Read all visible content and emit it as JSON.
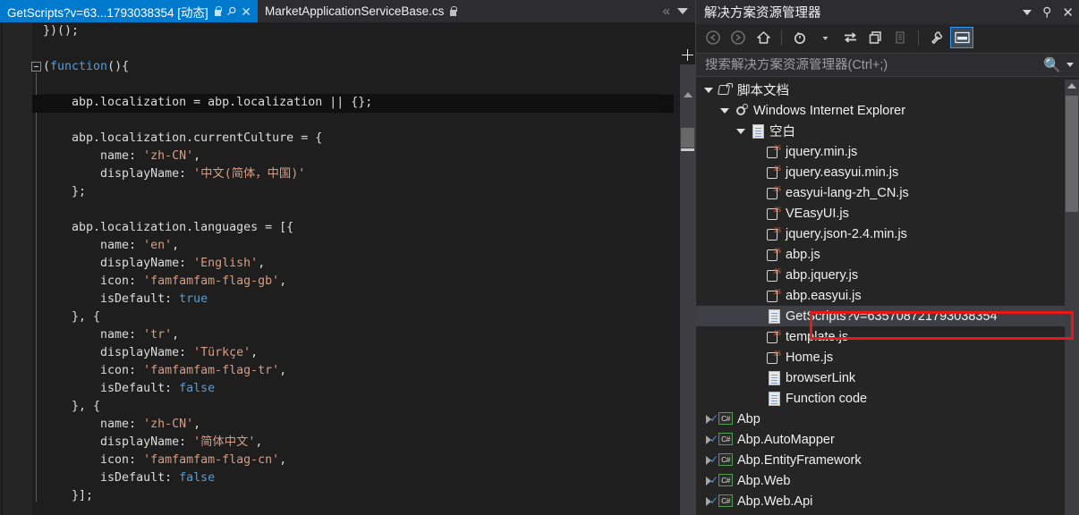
{
  "editor": {
    "tabs": [
      {
        "label": "GetScripts?v=63...1793038354 [动态]",
        "active": true,
        "lock_icon": "lock-icon",
        "pin_icon": "pin-icon",
        "close_icon": "close-icon"
      },
      {
        "label": "MarketApplicationServiceBase.cs",
        "active": false,
        "lock_icon": "lock-icon"
      }
    ],
    "tabstrip_overflow_icon": "double-chevron-left-icon",
    "tabstrip_dropdown_icon": "tab-list-dropdown-icon",
    "split_view_icon": "split-view-icon",
    "code_lines": [
      "})();",
      "",
      "(function(){",
      "",
      "    abp.localization = abp.localization || {};",
      "",
      "    abp.localization.currentCulture = {",
      "        name: 'zh-CN',",
      "        displayName: '中文(简体，中国)'",
      "    };",
      "",
      "    abp.localization.languages = [{",
      "        name: 'en',",
      "        displayName: 'English',",
      "        icon: 'famfamfam-flag-gb',",
      "        isDefault: true",
      "    }, {",
      "        name: 'tr',",
      "        displayName: 'Türkçe',",
      "        icon: 'famfamfam-flag-tr',",
      "        isDefault: false",
      "    }, {",
      "        name: 'zh-CN',",
      "        displayName: '简体中文',",
      "        icon: 'famfamfam-flag-cn',",
      "        isDefault: false",
      "    }];"
    ],
    "highlighted_line_index": 4
  },
  "solution_explorer": {
    "title": "解决方案资源管理器",
    "title_buttons": {
      "dropdown_icon": "chevron-down-icon",
      "pin_icon": "pin-icon",
      "close_icon": "close-icon"
    },
    "toolbar": [
      {
        "name": "back-icon",
        "enabled": false
      },
      {
        "name": "forward-icon",
        "enabled": false
      },
      {
        "name": "home-icon",
        "enabled": true
      },
      {
        "name": "pending-changes-filter-icon",
        "enabled": true
      },
      {
        "name": "pending-changes-dropdown-icon",
        "enabled": true
      },
      {
        "name": "sync-with-active-document-icon",
        "enabled": true
      },
      {
        "name": "refresh-collapse-all-icon",
        "enabled": true
      },
      {
        "name": "show-all-files-icon",
        "enabled": false
      },
      {
        "name": "properties-wrench-icon",
        "enabled": true
      },
      {
        "name": "preview-selected-items-icon",
        "enabled": true,
        "active": true
      }
    ],
    "search": {
      "placeholder": "搜索解决方案资源管理器(Ctrl+;)",
      "value": "",
      "icon": "search-icon",
      "dropdown_icon": "chevron-down-icon"
    },
    "tree": [
      {
        "label": "脚本文档",
        "indent": 0,
        "icon": "script-documents-icon",
        "expander": "down"
      },
      {
        "label": "Windows Internet Explorer",
        "indent": 1,
        "icon": "internet-explorer-gear-icon",
        "expander": "down"
      },
      {
        "label": "空白",
        "indent": 2,
        "icon": "document-icon",
        "expander": "down"
      },
      {
        "label": "jquery.min.js",
        "indent": 3,
        "icon": "javascript-file-icon",
        "expander": "none"
      },
      {
        "label": "jquery.easyui.min.js",
        "indent": 3,
        "icon": "javascript-file-icon",
        "expander": "none"
      },
      {
        "label": "easyui-lang-zh_CN.js",
        "indent": 3,
        "icon": "javascript-file-icon",
        "expander": "none"
      },
      {
        "label": "VEasyUI.js",
        "indent": 3,
        "icon": "javascript-file-icon",
        "expander": "none"
      },
      {
        "label": "jquery.json-2.4.min.js",
        "indent": 3,
        "icon": "javascript-file-icon",
        "expander": "none"
      },
      {
        "label": "abp.js",
        "indent": 3,
        "icon": "javascript-file-icon",
        "expander": "none"
      },
      {
        "label": "abp.jquery.js",
        "indent": 3,
        "icon": "javascript-file-icon",
        "expander": "none"
      },
      {
        "label": "abp.easyui.js",
        "indent": 3,
        "icon": "javascript-file-icon",
        "expander": "none"
      },
      {
        "label": "GetScripts?v=635708721793038354",
        "indent": 3,
        "icon": "document-icon",
        "expander": "none",
        "selected": true,
        "annotated": true
      },
      {
        "label": "template.js",
        "indent": 3,
        "icon": "javascript-file-icon",
        "expander": "none"
      },
      {
        "label": "Home.js",
        "indent": 3,
        "icon": "javascript-file-icon",
        "expander": "none"
      },
      {
        "label": "browserLink",
        "indent": 3,
        "icon": "document-icon",
        "expander": "none"
      },
      {
        "label": "Function code",
        "indent": 3,
        "icon": "document-icon",
        "expander": "none"
      },
      {
        "label": "Abp",
        "indent": 0,
        "icon": "csharp-project-icon",
        "expander": "right"
      },
      {
        "label": "Abp.AutoMapper",
        "indent": 0,
        "icon": "csharp-project-icon",
        "expander": "right"
      },
      {
        "label": "Abp.EntityFramework",
        "indent": 0,
        "icon": "csharp-project-icon",
        "expander": "right"
      },
      {
        "label": "Abp.Web",
        "indent": 0,
        "icon": "csharp-project-icon",
        "expander": "right"
      },
      {
        "label": "Abp.Web.Api",
        "indent": 0,
        "icon": "csharp-project-icon",
        "expander": "right"
      }
    ]
  },
  "colors": {
    "accent_blue": "#007acc",
    "annotation_red": "#e61919",
    "editor_bg": "#1e1e1e",
    "panel_bg": "#252526",
    "selection_bg": "#3f3f46"
  }
}
